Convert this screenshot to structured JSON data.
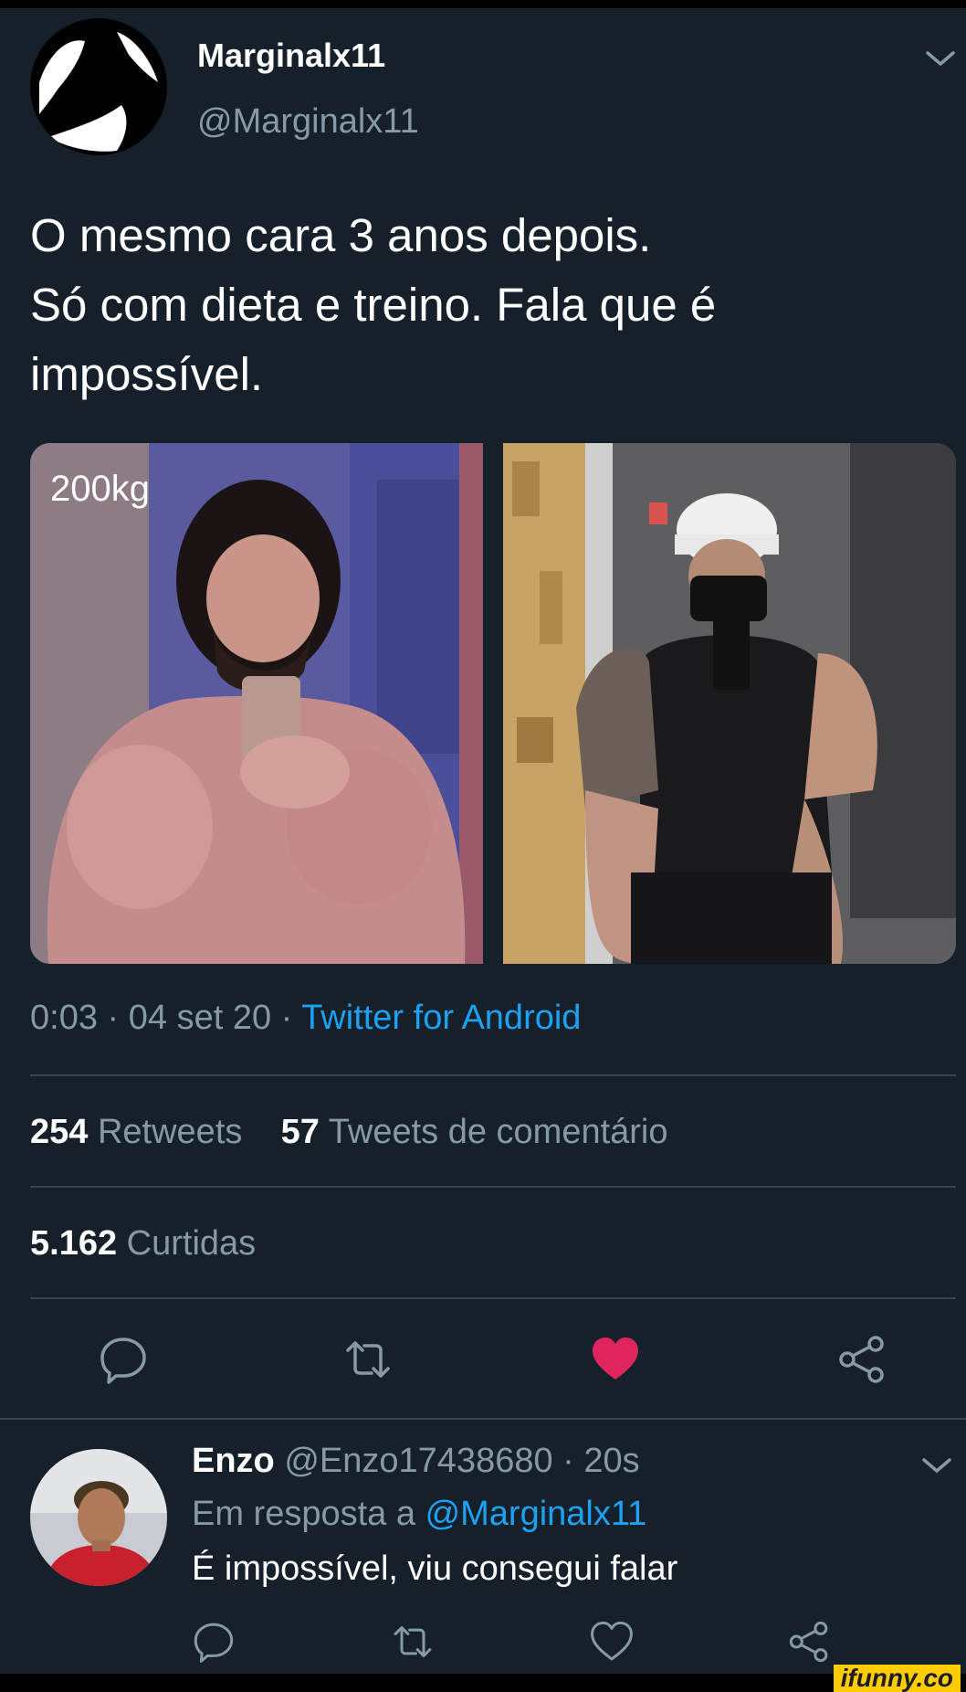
{
  "tweet": {
    "author": {
      "name": "Marginalx11",
      "handle": "@Marginalx11"
    },
    "text_lines": [
      "O mesmo cara 3 anos depois.",
      "Só com dieta e treino. Fala que é",
      "impossível."
    ],
    "photos": [
      {
        "caption": "200kg",
        "icon": "before-photo"
      },
      {
        "icon": "after-photo"
      }
    ],
    "meta": {
      "time": "0:03",
      "date": "04 set 20",
      "source": "Twitter for Android",
      "separator": "·"
    },
    "stats": {
      "retweets_count": "254",
      "retweets_label": "Retweets",
      "quotes_count": "57",
      "quotes_label": "Tweets de comentário",
      "likes_count": "5.162",
      "likes_label": "Curtidas"
    },
    "actions": [
      {
        "icon": "reply-icon"
      },
      {
        "icon": "retweet-icon"
      },
      {
        "icon": "heart-filled-icon",
        "color": "#e0245e"
      },
      {
        "icon": "share-icon"
      }
    ]
  },
  "reply": {
    "author_name": "Enzo",
    "author_handle": "@Enzo17438680",
    "time": "20s",
    "separator": "·",
    "context_label": "Em resposta a",
    "context_mention": "@Marginalx11",
    "text": "É impossível, viu consegui falar",
    "actions": [
      "reply-icon",
      "retweet-icon",
      "heart-icon",
      "share-icon"
    ]
  },
  "watermark": "ifunny.co",
  "colors": {
    "background": "#15202b",
    "secondary_text": "#8899a6",
    "link": "#1da1f2",
    "like": "#e0245e",
    "divider": "#38444d"
  }
}
